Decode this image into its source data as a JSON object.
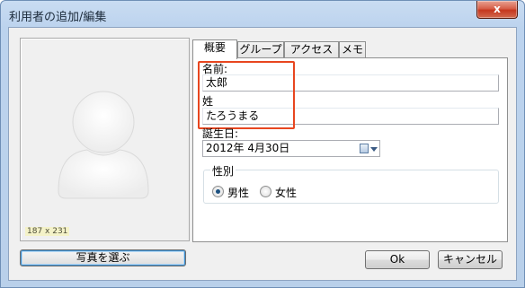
{
  "window": {
    "title": "利用者の追加/編集",
    "close_glyph": "x"
  },
  "photo": {
    "size_label": "187 x 231",
    "choose_button": "写真を選ぶ"
  },
  "tabs": [
    "概要",
    "グループ",
    "アクセス権",
    "メモ"
  ],
  "form": {
    "first_name_label": "名前:",
    "first_name_value": "太郎",
    "last_name_label": "姓",
    "last_name_value": "たろうまる",
    "birthday_label": "誕生日:",
    "birthday_value": "2012年  4月30日",
    "gender_legend": "性別",
    "gender_options": [
      {
        "label": "男性",
        "checked": true
      },
      {
        "label": "女性",
        "checked": false
      }
    ]
  },
  "buttons": {
    "ok": "Ok",
    "cancel": "キャンセル"
  },
  "colors": {
    "highlight": "#e8461f",
    "close": "#c5371e"
  }
}
